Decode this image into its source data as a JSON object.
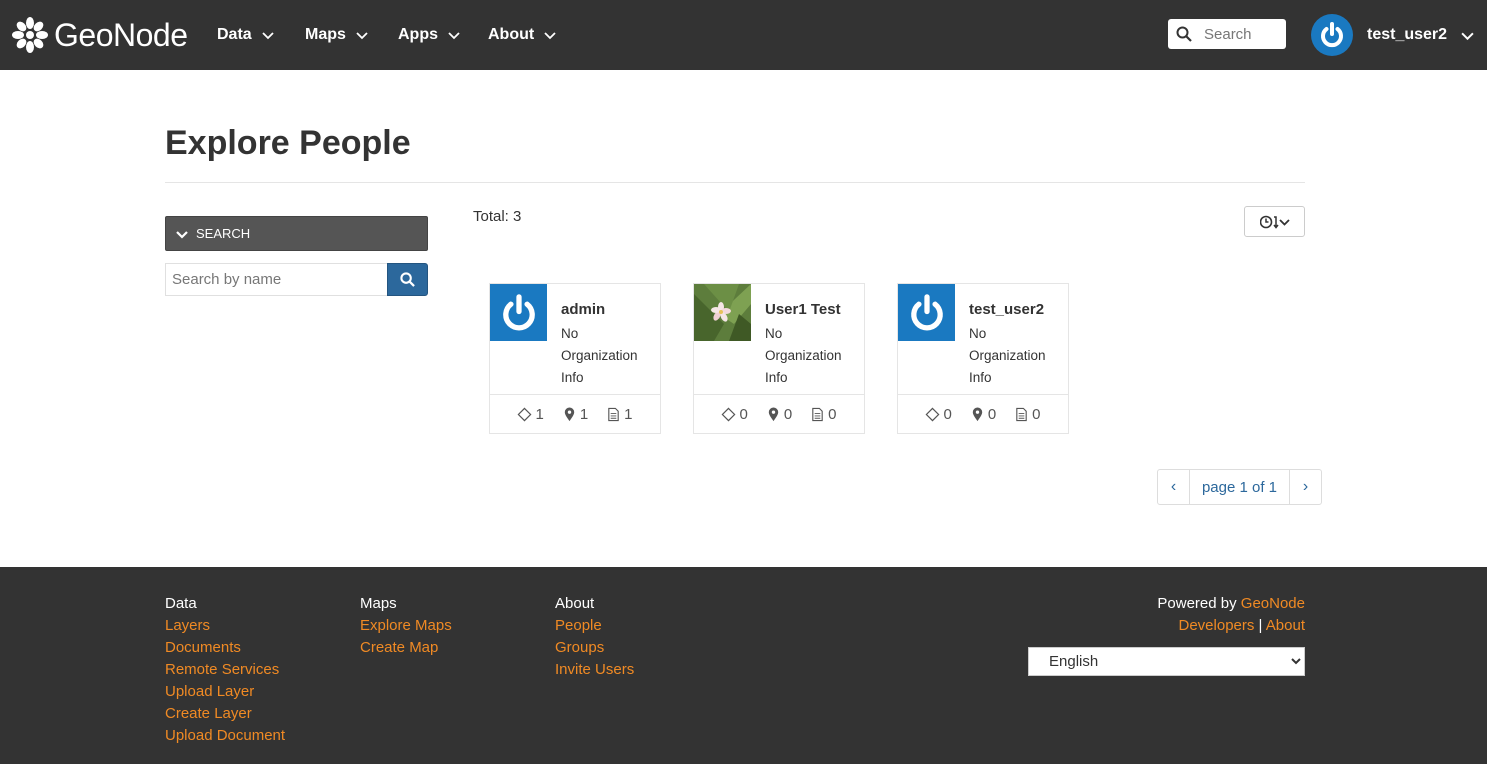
{
  "navbar": {
    "brand": "GeoNode",
    "menu": [
      {
        "label": "Data"
      },
      {
        "label": "Maps"
      },
      {
        "label": "Apps"
      },
      {
        "label": "About"
      }
    ],
    "search_placeholder": "Search",
    "user": "test_user2",
    "background": "#333333"
  },
  "page": {
    "title": "Explore People",
    "search_panel_label": "SEARCH",
    "name_search_placeholder": "Search by name",
    "total_label": "Total: 3"
  },
  "people": [
    {
      "name": "admin",
      "org_line1": "No",
      "org_line2": "Organization",
      "org_line3": "Info",
      "avatar": "power-icon",
      "layers": "1",
      "maps": "1",
      "documents": "1"
    },
    {
      "name": "User1 Test",
      "org_line1": "No",
      "org_line2": "Organization",
      "org_line3": "Info",
      "avatar": "flower-photo",
      "layers": "0",
      "maps": "0",
      "documents": "0"
    },
    {
      "name": "test_user2",
      "org_line1": "No",
      "org_line2": "Organization",
      "org_line3": "Info",
      "avatar": "power-icon",
      "layers": "0",
      "maps": "0",
      "documents": "0"
    }
  ],
  "pagination": {
    "label": "page 1 of 1",
    "prev": "‹",
    "next": "›"
  },
  "footer": {
    "data": {
      "heading": "Data",
      "links": [
        "Layers",
        "Documents",
        "Remote Services",
        "Upload Layer",
        "Create Layer",
        "Upload Document"
      ]
    },
    "maps": {
      "heading": "Maps",
      "links": [
        "Explore Maps",
        "Create Map"
      ]
    },
    "about": {
      "heading": "About",
      "links": [
        "People",
        "Groups",
        "Invite Users"
      ]
    },
    "powered_prefix": "Powered by",
    "powered_link": "GeoNode",
    "developers_link": "Developers",
    "separator": "|",
    "about_link": "About",
    "language_selected": "English"
  },
  "colors": {
    "accent_link": "#f08a24",
    "primary_blue": "#2c689c",
    "avatar_blue": "#1a79c1"
  }
}
